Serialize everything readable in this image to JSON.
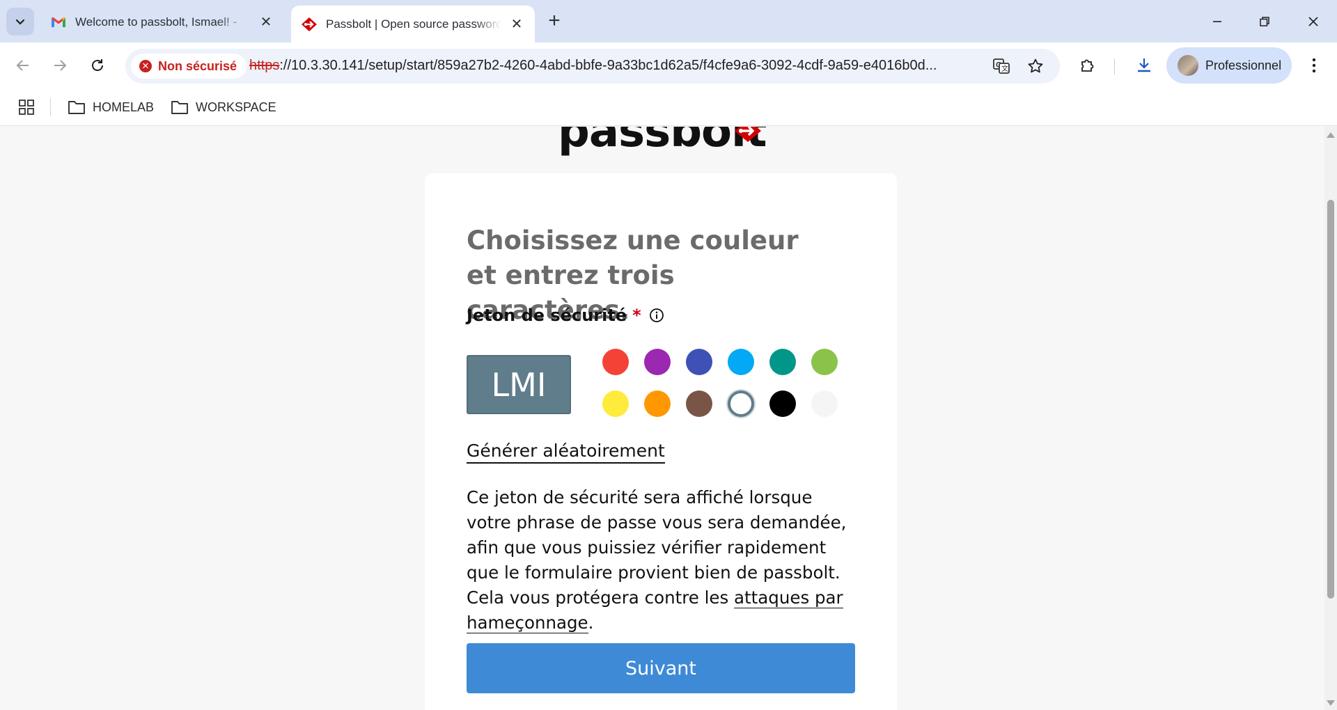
{
  "browser": {
    "tabs": [
      {
        "title": "Welcome to passbolt, Ismael! - ",
        "favicon": "gmail-icon",
        "active": false
      },
      {
        "title": "Passbolt | Open source password manager",
        "favicon": "passbolt-icon",
        "active": true
      }
    ],
    "address": {
      "security_label": "Non sécurisé",
      "scheme": "https",
      "rest": "://10.3.30.141/setup/start/859a27b2-4260-4abd-bbfe-9a33bc1d62a5/f4cfe9a6-3092-4cdf-9a59-e4016b0d..."
    },
    "profile_label": "Professionnel",
    "bookmarks": [
      {
        "label": "HOMELAB"
      },
      {
        "label": "WORKSPACE"
      }
    ]
  },
  "page": {
    "title": "Choisissez une couleur et entrez trois caractères.",
    "field_label": "Jeton de sécurité",
    "required_mark": "*",
    "token_text": "LMI",
    "token_color": "#607d8b",
    "swatch_colors": [
      [
        "#f44336",
        "#9c27b0",
        "#3f51b5",
        "#03a9f4",
        "#009688",
        "#8bc34a"
      ],
      [
        "#ffeb3b",
        "#ff9800",
        "#795548",
        "#607d8b",
        "#000000",
        "#f5f5f5"
      ]
    ],
    "selected_swatch": "#607d8b",
    "random_link": "Générer aléatoirement",
    "help_text_before": "Ce jeton de sécurité sera affiché lorsque votre phrase de passe vous sera demandée, afin que vous puissiez vérifier rapidement que le formulaire provient bien de passbolt. Cela vous protégera contre les ",
    "help_link": "attaques par hameçonnage",
    "help_text_after": ".",
    "next_button": "Suivant",
    "accent_color": "#3e8ad6"
  }
}
